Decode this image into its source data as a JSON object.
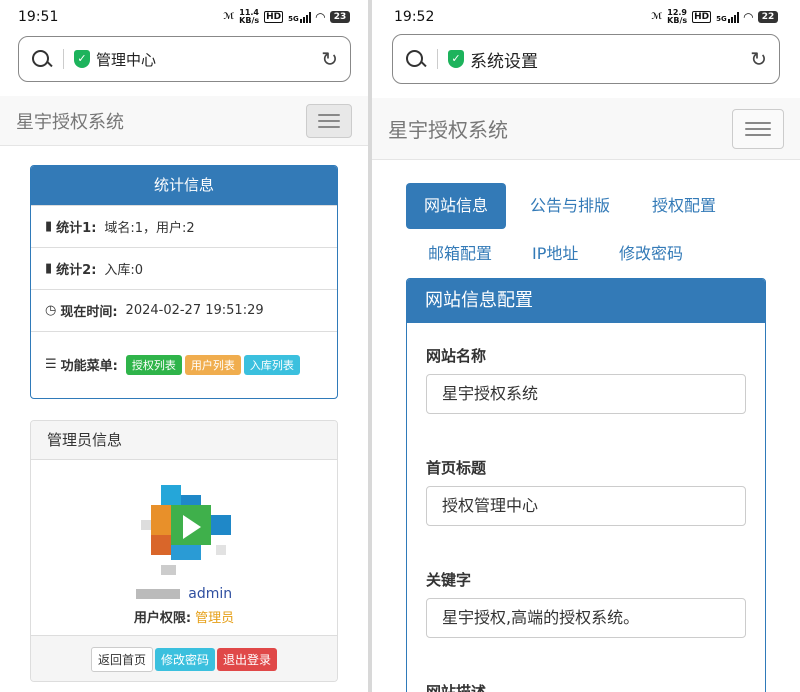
{
  "left": {
    "status": {
      "time": "19:51",
      "net_speed": "11.4",
      "net_unit": "KB/s",
      "hd": "HD",
      "five_g": "5G",
      "battery": "23"
    },
    "url": {
      "text": "管理中心"
    },
    "brand": "星宇授权系统",
    "stats_panel": {
      "title": "统计信息",
      "stat1_label": "统计1:",
      "stat1_value": "域名:1，用户:2",
      "stat2_label": "统计2:",
      "stat2_value": "入库:0",
      "time_label": "现在时间:",
      "time_value": "2024-02-27 19:51:29",
      "menu_label": "功能菜单:",
      "menu_buttons": [
        "授权列表",
        "用户列表",
        "入库列表"
      ]
    },
    "admin_panel": {
      "title": "管理员信息",
      "username": "admin",
      "permission_label": "用户权限:",
      "permission_value": "管理员",
      "buttons": [
        "返回首页",
        "修改密码",
        "退出登录"
      ]
    }
  },
  "right": {
    "status": {
      "time": "19:52",
      "net_speed": "12.9",
      "net_unit": "KB/s",
      "hd": "HD",
      "five_g": "5G",
      "battery": "22"
    },
    "url": {
      "text": "系统设置"
    },
    "brand": "星宇授权系统",
    "tabs": [
      "网站信息",
      "公告与排版",
      "授权配置",
      "邮箱配置",
      "IP地址",
      "修改密码"
    ],
    "config_panel": {
      "title": "网站信息配置",
      "fields": [
        {
          "label": "网站名称",
          "value": "星宇授权系统"
        },
        {
          "label": "首页标题",
          "value": "授权管理中心"
        },
        {
          "label": "关键字",
          "value": "星宇授权,高端的授权系统。"
        },
        {
          "label": "网站描述",
          "value": ""
        }
      ]
    }
  },
  "colors": {
    "primary": "#337ab7",
    "success": "#2fb44a",
    "warning": "#f0ad4e",
    "info": "#3bc0de",
    "danger": "#e04848",
    "secure": "#1db35c"
  }
}
